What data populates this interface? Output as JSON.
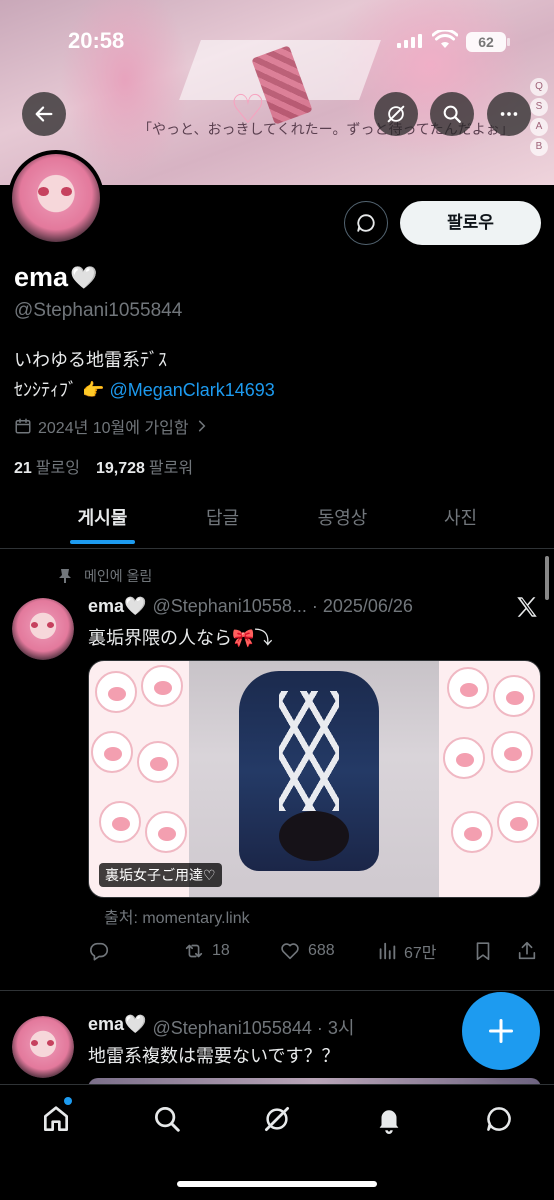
{
  "status_bar": {
    "time": "20:58",
    "battery": "62"
  },
  "banner": {
    "quote": "「やっと、おっきしてくれたー。ずっと待ってたんだよぉ」",
    "side_labels": [
      "Q",
      "S",
      "A",
      "B"
    ]
  },
  "profile": {
    "display_name": "ema",
    "name_emoji": "🤍",
    "handle": "@Stephani1055844",
    "bio_line1": "いわゆる地雷系ﾃﾞｽ",
    "bio_line2_prefix": "ｾﾝｼﾃｨﾌﾞ 👉",
    "bio_mention": "@MeganClark14693",
    "joined": "2024년 10월에 가입함",
    "following_count": "21",
    "following_label": "팔로잉",
    "followers_count": "19,728",
    "followers_label": "팔로워",
    "follow_button": "팔로우"
  },
  "tabs": [
    {
      "label": "게시물",
      "active": true
    },
    {
      "label": "답글",
      "active": false
    },
    {
      "label": "동영상",
      "active": false
    },
    {
      "label": "사진",
      "active": false
    }
  ],
  "tweets": [
    {
      "pinned_label": "메인에 올림",
      "name": "ema🤍",
      "handle_time": "@Stephani10558... · 2025/06/26",
      "text": "裏垢界隈の人なら🎀⤵︎",
      "media_caption": "裏垢女子ご用達♡",
      "source": "출처: momentary.link",
      "retweets": "18",
      "likes": "688",
      "views": "67만"
    },
    {
      "name": "ema🤍",
      "handle_time": "@Stephani1055844 · 3시",
      "text": "地雷系複数は需要ないです？？"
    }
  ],
  "colors": {
    "accent": "#1d9bf0",
    "muted": "#71767b",
    "text": "#e7e9ea",
    "divider": "#2f3336",
    "background": "#000000"
  },
  "icons": {
    "back": "arrow-left-icon",
    "grok": "grok-icon",
    "search": "search-icon",
    "more": "more-horizontal-icon",
    "message": "message-icon",
    "calendar": "calendar-icon",
    "pin": "pin-icon",
    "x_logo": "x-logo-icon",
    "reply": "reply-icon",
    "retweet": "retweet-icon",
    "like": "heart-icon",
    "views": "views-icon",
    "bookmark": "bookmark-icon",
    "share": "share-icon",
    "compose": "plus-icon",
    "nav_home": "home-icon",
    "nav_search": "search-icon",
    "nav_grok": "grok-icon",
    "nav_notifications": "bell-icon",
    "nav_messages": "message-icon"
  }
}
